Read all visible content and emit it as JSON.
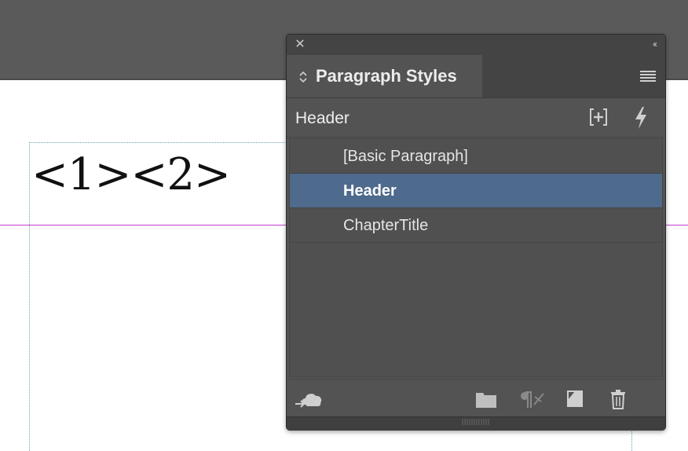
{
  "document": {
    "text": "<1><2>"
  },
  "panel": {
    "tab_title": "Paragraph Styles",
    "current_style": "Header",
    "styles": [
      {
        "label": "[Basic Paragraph]",
        "selected": false
      },
      {
        "label": "Header",
        "selected": true
      },
      {
        "label": "ChapterTitle",
        "selected": false
      }
    ],
    "colors": {
      "panel_bg": "#535353",
      "selected_row": "#4e6a8c",
      "guide": "#c13fd0"
    }
  }
}
